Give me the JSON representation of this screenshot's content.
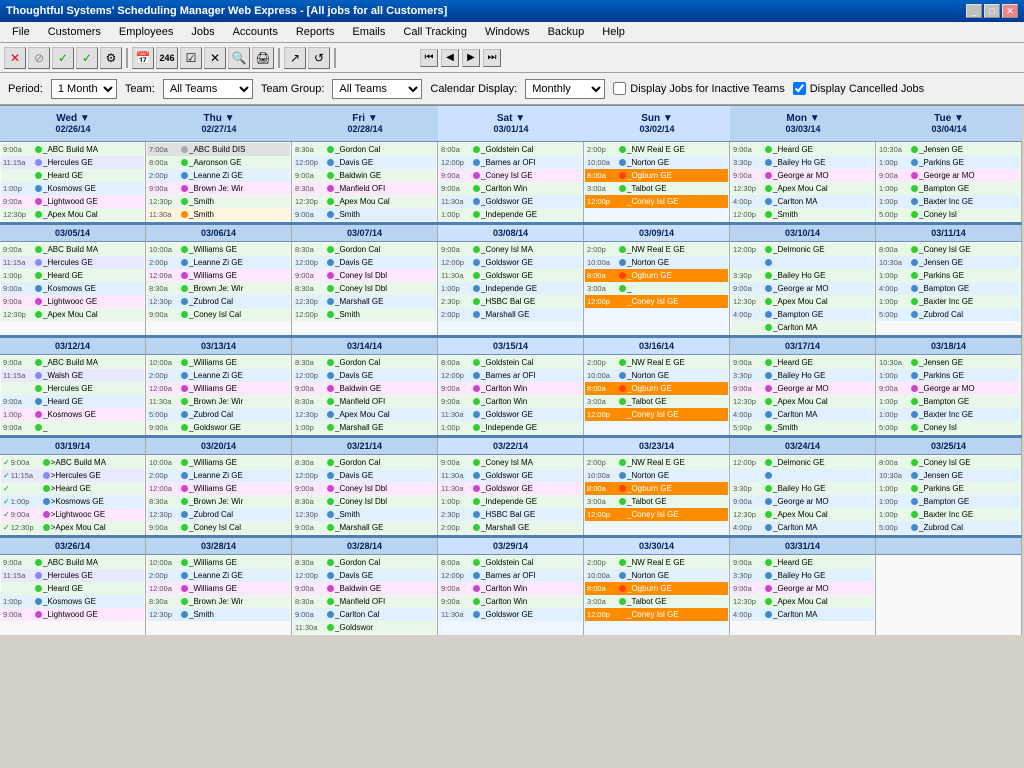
{
  "app": {
    "title": "Thoughtful Systems' Scheduling Manager Web Express - [All jobs for all Customers]",
    "menu": [
      "File",
      "Customers",
      "Employees",
      "Jobs",
      "Accounts",
      "Reports",
      "Emails",
      "Call Tracking",
      "Windows",
      "Backup",
      "Help"
    ]
  },
  "toolbar": {
    "nav_buttons": [
      "⏮",
      "◀",
      "▶",
      "⏭"
    ]
  },
  "filter": {
    "period_label": "Period:",
    "period_value": "1 Month",
    "team_label": "Team:",
    "team_value": "All Teams",
    "team_group_label": "Team Group:",
    "team_group_value": "All Teams",
    "calendar_display_label": "Calendar Display:",
    "calendar_display_value": "Monthly",
    "inactive_teams_label": "Display Jobs for Inactive Teams",
    "cancelled_jobs_label": "Display Cancelled Jobs"
  },
  "calendar": {
    "headers": [
      {
        "dow": "Wed",
        "date": "02/26/14",
        "type": "weekday"
      },
      {
        "dow": "Thu",
        "date": "02/27/14",
        "type": "weekday"
      },
      {
        "dow": "Fri",
        "date": "02/28/14",
        "type": "weekday"
      },
      {
        "dow": "Sat",
        "date": "03/01/14",
        "type": "weekend"
      },
      {
        "dow": "Sun",
        "date": "03/02/14",
        "type": "weekend"
      },
      {
        "dow": "Mon",
        "date": "03/03/14",
        "type": "weekday"
      },
      {
        "dow": "Tue",
        "date": "03/04/14",
        "type": "weekday"
      }
    ],
    "weeks": [
      {
        "days": [
          {
            "events": [
              {
                "time": "9:00a",
                "dot": "g",
                "name": "_ABC Build MA",
                "suf": "",
                "bg": "g"
              },
              {
                "time": "11:15a",
                "dot": "lb",
                "name": "_Hercules GE",
                "suf": "",
                "bg": "lb"
              },
              {
                "time": "",
                "dot": "g",
                "name": "_Heard   GE",
                "suf": "",
                "bg": "g"
              },
              {
                "time": "1:00p",
                "dot": "b",
                "name": "_Kosmows GE",
                "suf": "",
                "bg": "b"
              },
              {
                "time": "9:00a",
                "dot": "p",
                "name": "_Lightwoo GE",
                "suf": "",
                "bg": "p"
              },
              {
                "time": "12:30p",
                "dot": "g",
                "name": "_Apex Mou Cal",
                "suf": "",
                "bg": "g"
              }
            ]
          },
          {
            "events": [
              {
                "time": "7:00a",
                "dot": "w",
                "name": "_ABC Build DIS",
                "suf": "",
                "bg": "w",
                "highlight": false
              },
              {
                "time": "8:00a",
                "dot": "g",
                "name": "_Aaronson GE",
                "suf": "",
                "bg": "g"
              },
              {
                "time": "2:00p",
                "dot": "b",
                "name": "_Leanne Zi GE",
                "suf": "",
                "bg": "b"
              },
              {
                "time": "9:00a",
                "dot": "p",
                "name": "_Brown Je: Wir",
                "suf": "",
                "bg": "p"
              },
              {
                "time": "12:30p",
                "dot": "g",
                "name": "_Smith",
                "suf": "",
                "bg": "g"
              },
              {
                "time": "11:30a",
                "dot": "o",
                "name": "_Smith",
                "suf": "",
                "bg": "o"
              }
            ]
          },
          {
            "events": [
              {
                "time": "8:30a",
                "dot": "g",
                "name": "_Gordon  Cal",
                "suf": "",
                "bg": "g"
              },
              {
                "time": "12:00p",
                "dot": "b",
                "name": "_Davis    GE",
                "suf": "",
                "bg": "b"
              },
              {
                "time": "9:00a",
                "dot": "g",
                "name": "_Baldwin  GE",
                "suf": "",
                "bg": "g"
              },
              {
                "time": "8:30a",
                "dot": "p",
                "name": "_Manfield OFI",
                "suf": "",
                "bg": "p"
              },
              {
                "time": "12:30p",
                "dot": "g",
                "name": "_Apex Mou Cal",
                "suf": "",
                "bg": "g"
              },
              {
                "time": "9:00a",
                "dot": "b",
                "name": "_Smith",
                "suf": "",
                "bg": "b"
              }
            ]
          },
          {
            "events": [
              {
                "time": "8:00a",
                "dot": "g",
                "name": "_Goldstein Cal",
                "suf": "",
                "bg": "g"
              },
              {
                "time": "12:00p",
                "dot": "b",
                "name": "_Barnes ar OFI",
                "suf": "",
                "bg": "b"
              },
              {
                "time": "9:00a",
                "dot": "p",
                "name": "_Coney Isl GE",
                "suf": "",
                "bg": "p"
              },
              {
                "time": "9:00a",
                "dot": "g",
                "name": "_Carlton   Win",
                "suf": "",
                "bg": "g"
              },
              {
                "time": "11:30a",
                "dot": "b",
                "name": "_Goldswor GE",
                "suf": "",
                "bg": "b"
              },
              {
                "time": "1:00p",
                "dot": "g",
                "name": "_Independe GE",
                "suf": "",
                "bg": "g"
              }
            ]
          },
          {
            "events": [
              {
                "time": "2:00p",
                "dot": "g",
                "name": "_NW Real E GE",
                "suf": "",
                "bg": "g"
              },
              {
                "time": "10:00a",
                "dot": "b",
                "name": "_Norton   GE",
                "suf": "",
                "bg": "b"
              },
              {
                "time": "8:00a",
                "dot": "r",
                "name": "_Ogburn   GE",
                "suf": "",
                "bg": "r",
                "highlight": true
              },
              {
                "time": "3:00a",
                "dot": "g",
                "name": "_Talbot    GE",
                "suf": "",
                "bg": "g"
              },
              {
                "time": "12:00p",
                "dot": "o",
                "name": "_Coney Isl GE",
                "suf": "",
                "bg": "o",
                "highlight": true
              }
            ]
          },
          {
            "events": [
              {
                "time": "9:00a",
                "dot": "g",
                "name": "_Heard    GE",
                "suf": "",
                "bg": "g"
              },
              {
                "time": "3:30p",
                "dot": "b",
                "name": "_Bailey Ho GE",
                "suf": "",
                "bg": "b"
              },
              {
                "time": "9:00a",
                "dot": "p",
                "name": "_George ar MO",
                "suf": "",
                "bg": "p"
              },
              {
                "time": "12:30p",
                "dot": "g",
                "name": "_Apex Mou Cal",
                "suf": "",
                "bg": "g"
              },
              {
                "time": "4:00p",
                "dot": "b",
                "name": "_Carlton   MA",
                "suf": "",
                "bg": "b"
              },
              {
                "time": "12:00p",
                "dot": "g",
                "name": "_Smith",
                "suf": "",
                "bg": "g"
              }
            ]
          },
          {
            "events": [
              {
                "time": "10:30a",
                "dot": "g",
                "name": "_Jensen   GE",
                "suf": "",
                "bg": "g"
              },
              {
                "time": "1:00p",
                "dot": "b",
                "name": "_Parkins   GE",
                "suf": "",
                "bg": "b"
              },
              {
                "time": "9:00a",
                "dot": "p",
                "name": "_George ar MO",
                "suf": "",
                "bg": "p"
              },
              {
                "time": "1:00p",
                "dot": "g",
                "name": "_Bampton  GE",
                "suf": "",
                "bg": "g"
              },
              {
                "time": "1:00p",
                "dot": "b",
                "name": "_Baxter Inc GE",
                "suf": "",
                "bg": "b"
              },
              {
                "time": "5:00p",
                "dot": "g",
                "name": "_Coney Isl",
                "suf": "",
                "bg": "g"
              }
            ]
          }
        ]
      },
      {
        "week_date": "03/05/14 - 03/11/14",
        "days": [
          {
            "header_date": "03/05/14",
            "events": [
              {
                "time": "9:00a",
                "dot": "g",
                "name": "_ABC Build MA",
                "suf": "",
                "bg": "g"
              },
              {
                "time": "11:15a",
                "dot": "lb",
                "name": "_Hercules GE",
                "suf": "",
                "bg": "lb"
              },
              {
                "time": "1:00p",
                "dot": "g",
                "name": "_Heard    GE",
                "suf": "",
                "bg": "g"
              },
              {
                "time": "9:00a",
                "dot": "b",
                "name": "_Kosmows GE",
                "suf": "",
                "bg": "b"
              },
              {
                "time": "9:00a",
                "dot": "p",
                "name": "_Lightwooc GE",
                "suf": "",
                "bg": "p"
              },
              {
                "time": "12:30p",
                "dot": "g",
                "name": "_Apex Mou Cal",
                "suf": "",
                "bg": "g"
              }
            ]
          },
          {
            "header_date": "03/06/14",
            "events": [
              {
                "time": "10:00a",
                "dot": "g",
                "name": "_Williams GE",
                "suf": "",
                "bg": "g"
              },
              {
                "time": "2:00p",
                "dot": "b",
                "name": "_Leanne Zi GE",
                "suf": "",
                "bg": "b"
              },
              {
                "time": "12:00a",
                "dot": "p",
                "name": "_Williams GE",
                "suf": "",
                "bg": "p"
              },
              {
                "time": "8:30a",
                "dot": "g",
                "name": "_Brown Je: Wir",
                "suf": "",
                "bg": "g"
              },
              {
                "time": "12:30p",
                "dot": "b",
                "name": "_Zubrod   Cal",
                "suf": "",
                "bg": "b"
              },
              {
                "time": "9:00a",
                "dot": "g",
                "name": "_Coney Isl Cal",
                "suf": "",
                "bg": "g"
              }
            ]
          },
          {
            "header_date": "03/07/14",
            "events": [
              {
                "time": "8:30a",
                "dot": "g",
                "name": "_Gordon  Cal",
                "suf": "",
                "bg": "g"
              },
              {
                "time": "12:00p",
                "dot": "b",
                "name": "_Davis    GE",
                "suf": "",
                "bg": "b"
              },
              {
                "time": "9:00a",
                "dot": "p",
                "name": "_Coney Isl Dbl",
                "suf": "",
                "bg": "p"
              },
              {
                "time": "8:30a",
                "dot": "g",
                "name": "_Coney Isl Dbl",
                "suf": "",
                "bg": "g"
              },
              {
                "time": "12:30p",
                "dot": "b",
                "name": "_Marshall  GE",
                "suf": "",
                "bg": "b"
              },
              {
                "time": "12:00p",
                "dot": "g",
                "name": "_Smith",
                "suf": "",
                "bg": "g"
              }
            ]
          },
          {
            "header_date": "03/08/14",
            "events": [
              {
                "time": "9:00a",
                "dot": "g",
                "name": "_Coney Isl MA",
                "suf": "",
                "bg": "g"
              },
              {
                "time": "12:00p",
                "dot": "b",
                "name": "_Goldswor GE",
                "suf": "",
                "bg": "b"
              },
              {
                "time": "11:30a",
                "dot": "g",
                "name": "_Goldswor GE",
                "suf": "",
                "bg": "g"
              },
              {
                "time": "1:00p",
                "dot": "b",
                "name": "_Independe GE",
                "suf": "",
                "bg": "b"
              },
              {
                "time": "2:30p",
                "dot": "g",
                "name": "_HSBC Bal GE",
                "suf": "",
                "bg": "g"
              },
              {
                "time": "2:00p",
                "dot": "b",
                "name": "_Marshall  GE",
                "suf": "",
                "bg": "b"
              }
            ]
          },
          {
            "header_date": "03/09/14",
            "events": [
              {
                "time": "2:00p",
                "dot": "g",
                "name": "_NW Real E GE",
                "suf": "",
                "bg": "g"
              },
              {
                "time": "10:00a",
                "dot": "b",
                "name": "_Norton   GE",
                "suf": "",
                "bg": "b"
              },
              {
                "time": "8:00a",
                "dot": "r",
                "name": "_Ogburn   GE",
                "suf": "",
                "bg": "r",
                "highlight": true
              },
              {
                "time": "3:00a",
                "dot": "g",
                "name": "_",
                "suf": "",
                "bg": "g"
              },
              {
                "time": "12:00p",
                "dot": "o",
                "name": "_Coney Isl GE",
                "suf": "",
                "bg": "o",
                "highlight": true
              }
            ]
          },
          {
            "header_date": "03/10/14",
            "events": [
              {
                "time": "12:00p",
                "dot": "g",
                "name": "_Delmonic GE",
                "suf": "",
                "bg": "g"
              },
              {
                "time": "",
                "dot": "b",
                "name": "_",
                "suf": "",
                "bg": "b"
              },
              {
                "time": "3:30p",
                "dot": "g",
                "name": "_Bailey Ho GE",
                "suf": "",
                "bg": "g"
              },
              {
                "time": "9:00a",
                "dot": "b",
                "name": "_George ar MO",
                "suf": "",
                "bg": "b"
              },
              {
                "time": "12:30p",
                "dot": "g",
                "name": "_Apex Mou Cal",
                "suf": "",
                "bg": "g"
              },
              {
                "time": "4:00p",
                "dot": "b",
                "name": "_Bampton  GE",
                "suf": "",
                "bg": "b"
              },
              {
                "time": "",
                "dot": "g",
                "name": "_Carlton   MA",
                "suf": "",
                "bg": "g"
              }
            ]
          },
          {
            "header_date": "03/11/14",
            "events": [
              {
                "time": "8:00a",
                "dot": "g",
                "name": "_Coney Isl GE",
                "suf": "",
                "bg": "g"
              },
              {
                "time": "10:30a",
                "dot": "b",
                "name": "_Jensen   GE",
                "suf": "",
                "bg": "b"
              },
              {
                "time": "1:00p",
                "dot": "g",
                "name": "_Parkins   GE",
                "suf": "",
                "bg": "g"
              },
              {
                "time": "4:00p",
                "dot": "b",
                "name": "_Bampton  GE",
                "suf": "",
                "bg": "b"
              },
              {
                "time": "1:00p",
                "dot": "g",
                "name": "_Baxter Inc GE",
                "suf": "",
                "bg": "g"
              },
              {
                "time": "5:00p",
                "dot": "b",
                "name": "_Zubrod   Cal",
                "suf": "",
                "bg": "b"
              }
            ]
          }
        ]
      }
    ]
  }
}
